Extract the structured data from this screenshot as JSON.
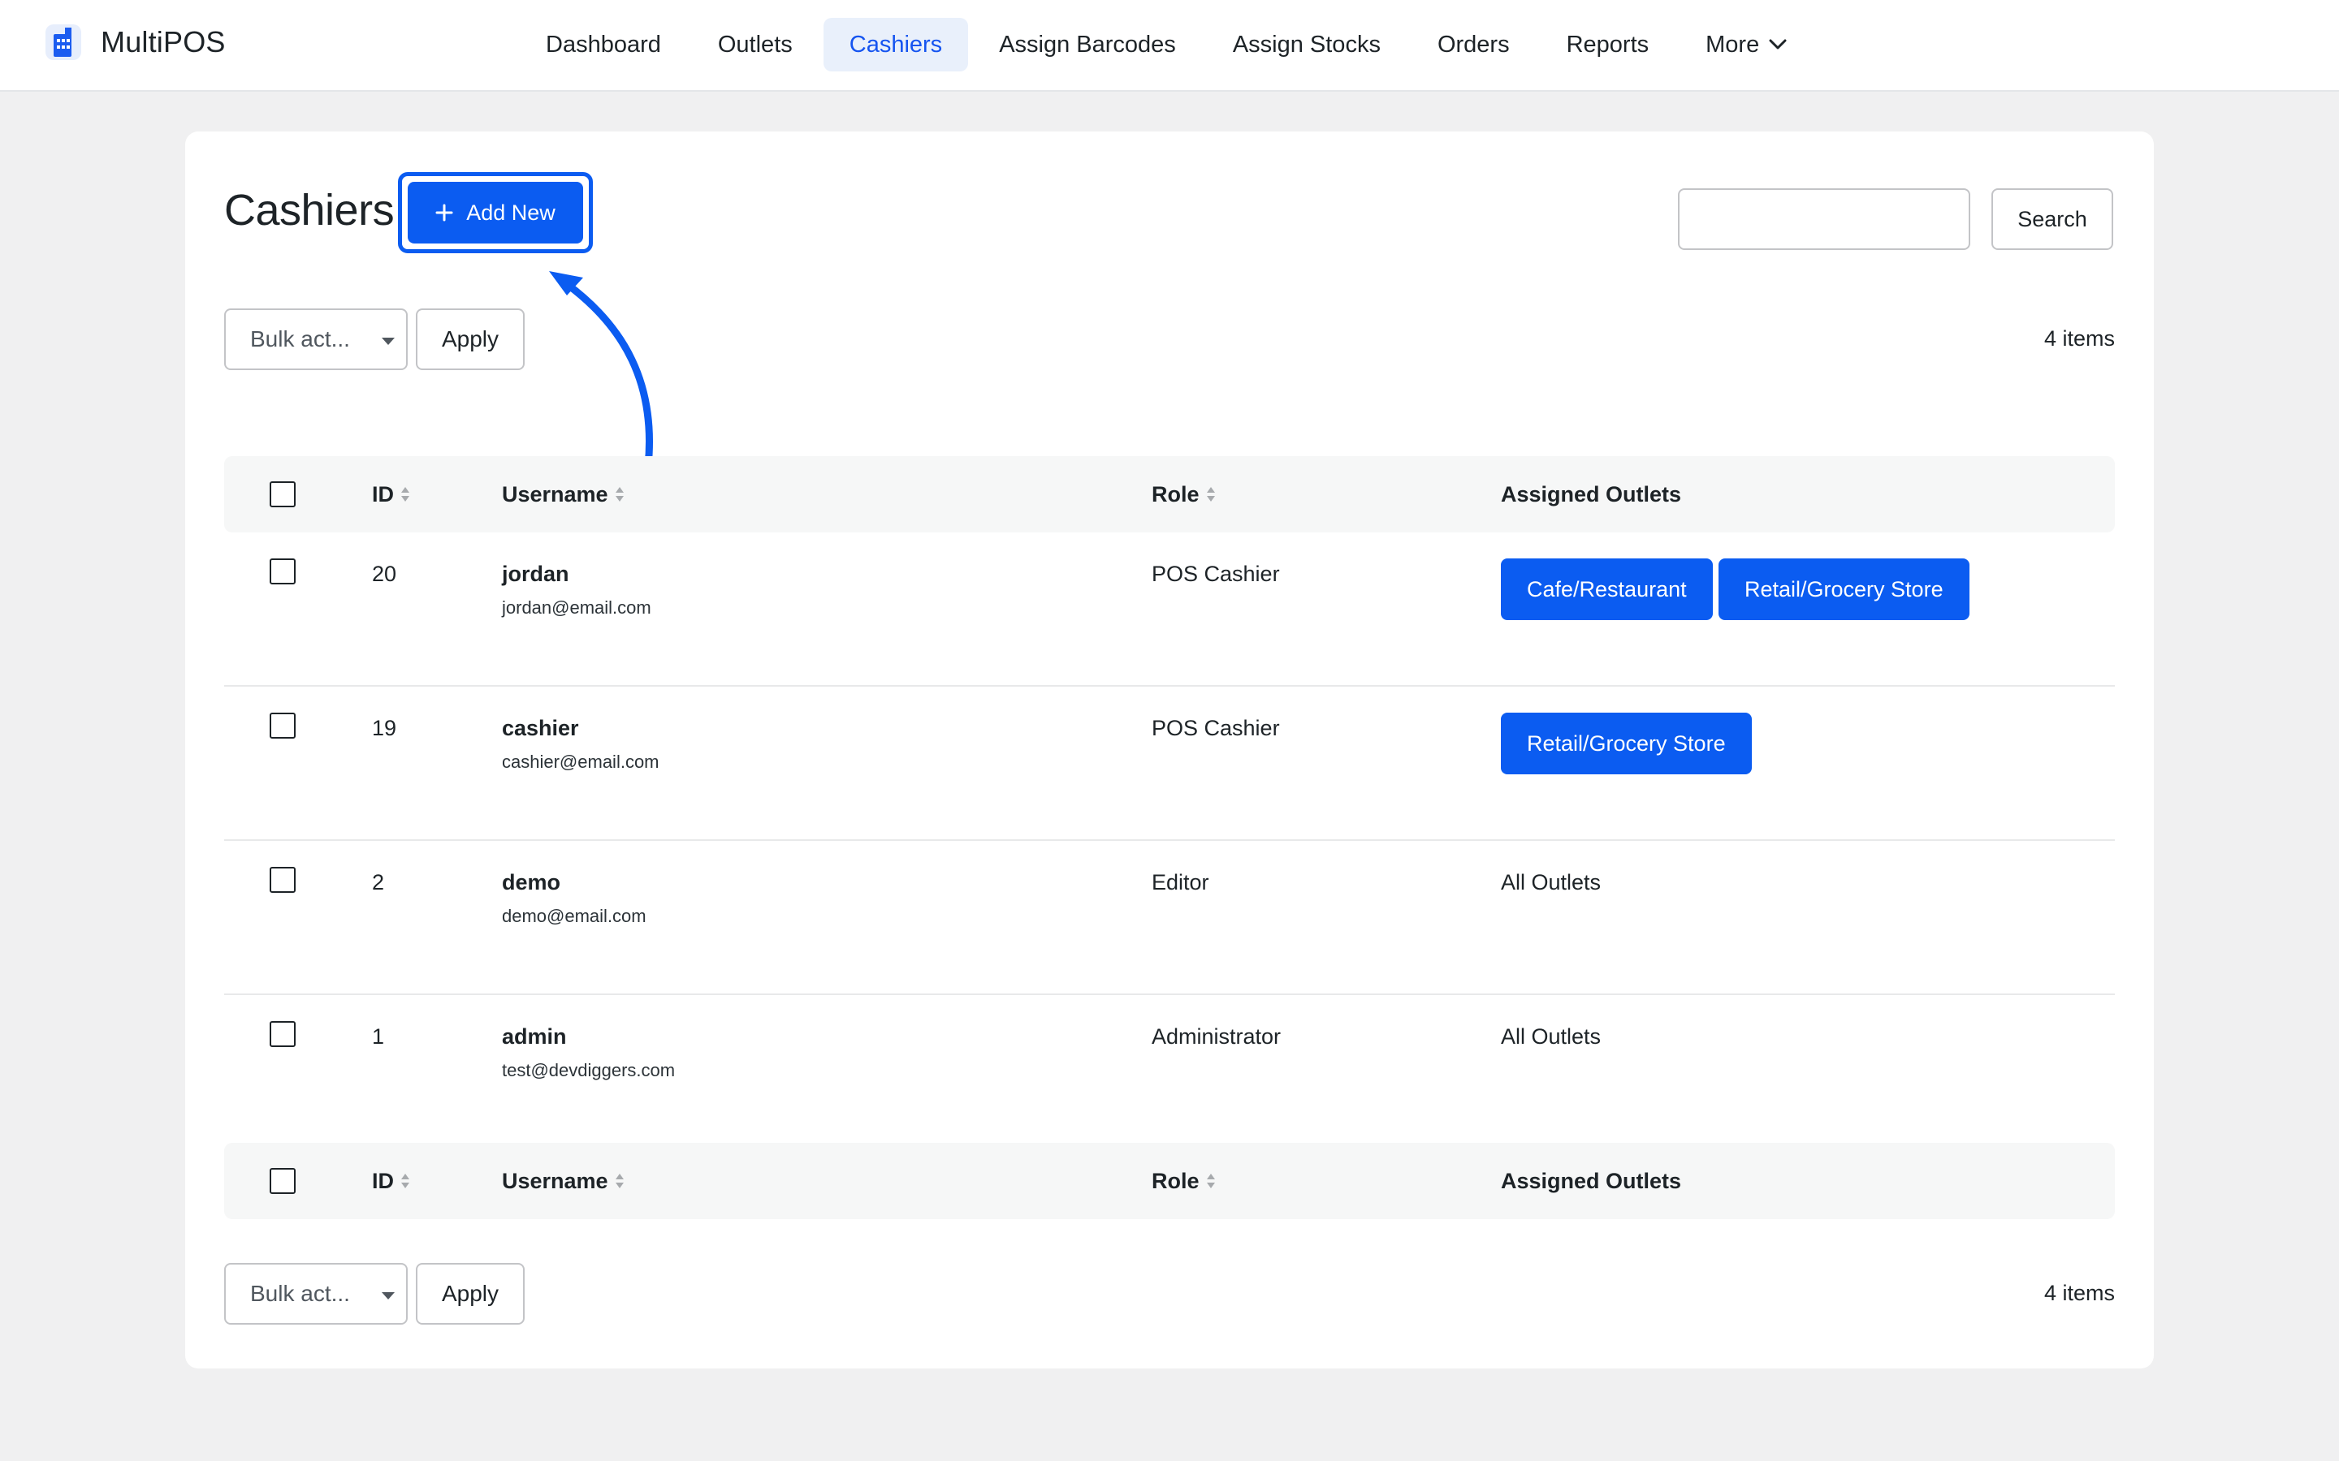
{
  "app": {
    "name": "MultiPOS",
    "logo_icon": "store-icon",
    "accent": "#0b5cf1"
  },
  "nav": {
    "items": [
      {
        "label": "Dashboard"
      },
      {
        "label": "Outlets"
      },
      {
        "label": "Cashiers",
        "active": true
      },
      {
        "label": "Assign Barcodes"
      },
      {
        "label": "Assign Stocks"
      },
      {
        "label": "Orders"
      },
      {
        "label": "Reports"
      },
      {
        "label": "More",
        "icon": "chevron-down-icon"
      }
    ]
  },
  "page": {
    "title": "Cashiers",
    "add_new_label": "Add New",
    "search": {
      "value": "",
      "button_label": "Search"
    },
    "bulk": {
      "select_label": "Bulk act...",
      "apply_label": "Apply"
    },
    "items_count": "4 items"
  },
  "table": {
    "columns": [
      "ID",
      "Username",
      "Role",
      "Assigned Outlets"
    ],
    "rows": [
      {
        "id": "20",
        "username": "jordan",
        "email": "jordan@email.com",
        "role": "POS Cashier",
        "outlets": [
          "Cafe/Restaurant",
          "Retail/Grocery Store"
        ]
      },
      {
        "id": "19",
        "username": "cashier",
        "email": "cashier@email.com",
        "role": "POS Cashier",
        "outlets": [
          "Retail/Grocery Store"
        ]
      },
      {
        "id": "2",
        "username": "demo",
        "email": "demo@email.com",
        "role": "Editor",
        "outlets_text": "All Outlets"
      },
      {
        "id": "1",
        "username": "admin",
        "email": "test@devdiggers.com",
        "role": "Administrator",
        "outlets_text": "All Outlets"
      }
    ]
  }
}
